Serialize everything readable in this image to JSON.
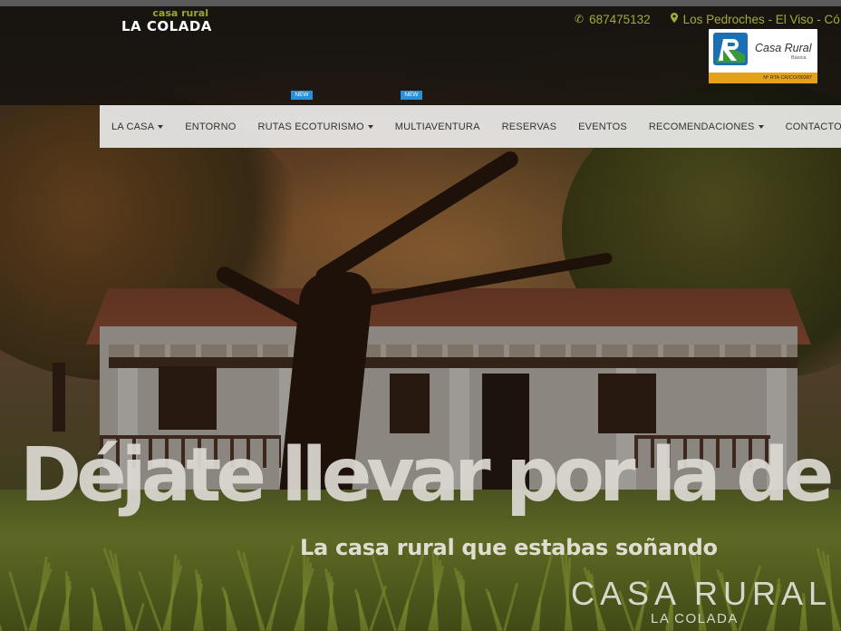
{
  "header": {
    "logo": {
      "small": "casa rural",
      "big": "LA COLADA"
    },
    "contact": {
      "phone": "687475132",
      "location": "Los Pedroches - El Viso - Có"
    },
    "badge": {
      "title": "Casa Rural",
      "subtitle": "Básica",
      "registry": "Nº RTA    CR/CO/00387"
    }
  },
  "nav": {
    "items": [
      {
        "label": "LA CASA",
        "dropdown": true
      },
      {
        "label": "ENTORNO",
        "dropdown": false
      },
      {
        "label": "RUTAS ECOTURISMO",
        "dropdown": true
      },
      {
        "label": "MULTIAVENTURA",
        "dropdown": false
      },
      {
        "label": "RESERVAS",
        "dropdown": false
      },
      {
        "label": "EVENTOS",
        "dropdown": false
      },
      {
        "label": "RECOMENDACIONES",
        "dropdown": true
      },
      {
        "label": "CONTACTO",
        "dropdown": false
      }
    ],
    "new_tag": "NEW"
  },
  "hero": {
    "headline": "Déjate llevar por la de",
    "subheadline": "La casa rural que estabas soñando",
    "brand_big": "CASA RURAL",
    "brand_small": "LA COLADA"
  },
  "colors": {
    "accent": "#a2ac35",
    "new_badge": "#2a8fd4",
    "badge_bar": "#e3a21a"
  }
}
